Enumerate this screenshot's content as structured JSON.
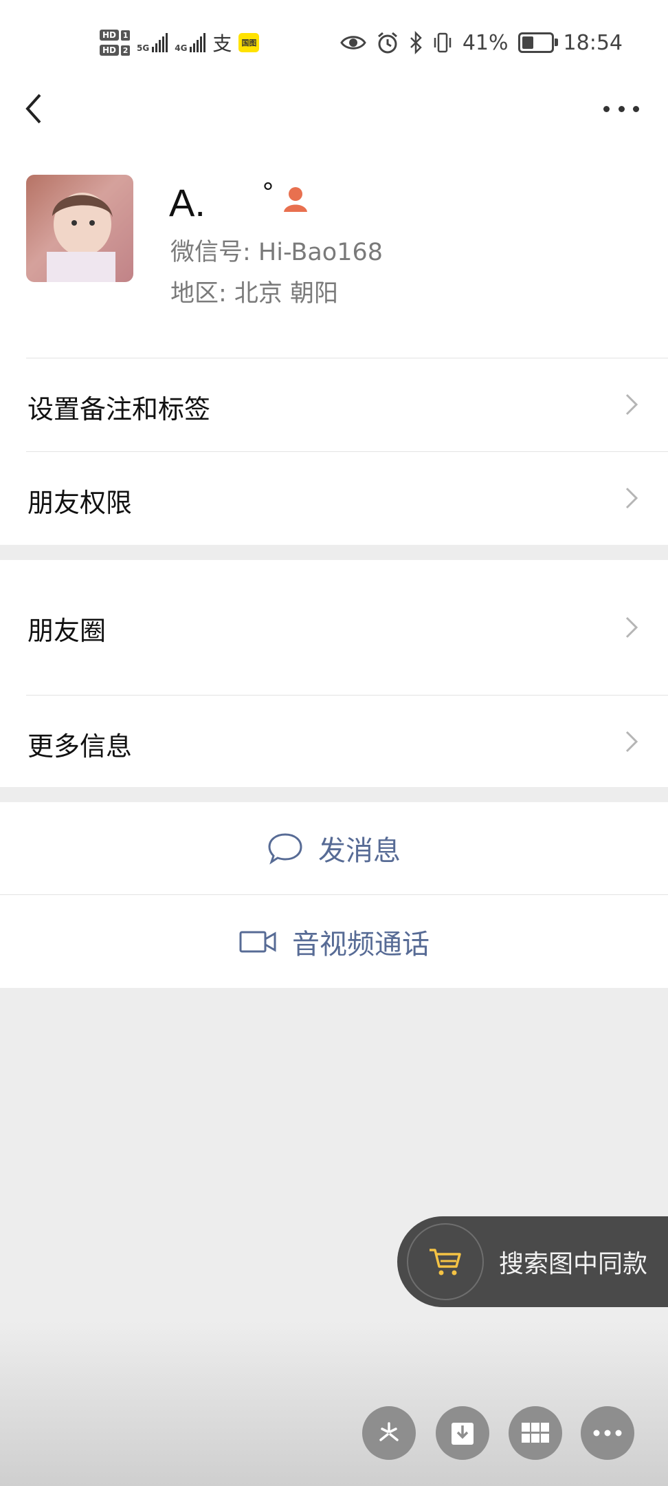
{
  "status_bar": {
    "hd1": "HD",
    "hd1_num": "1",
    "hd2": "HD",
    "hd2_num": "2",
    "net1": "5G",
    "net2": "4G",
    "pay_glyph": "支",
    "promo_badge": "国图",
    "battery_level_percent": 41,
    "battery_text": "41%",
    "time": "18:54",
    "icons": [
      "eye-icon",
      "alarm-icon",
      "bluetooth-icon",
      "vibrate-icon",
      "battery-icon"
    ]
  },
  "nav": {
    "back_icon": "chevron-left-icon",
    "more_icon": "more-dots-icon"
  },
  "profile": {
    "nickname": "A.",
    "nickname_suffix": "°",
    "gender_icon": "female-icon",
    "gender_color": "#e8704f",
    "wechat_id": "微信号:  Hi-Bao168",
    "region": "地区:  北京  朝阳"
  },
  "rows": [
    {
      "label": "设置备注和标签"
    },
    {
      "label": "朋友权限"
    },
    {
      "label": "朋友圈"
    },
    {
      "label": "更多信息"
    }
  ],
  "actions": {
    "message": "发消息",
    "video_call": "音视频通话",
    "accent_color": "#576b95"
  },
  "floating": {
    "search_similar": "搜索图中同款",
    "cart_color": "#f5c344"
  },
  "toolbar": {
    "buttons": [
      "sparkle-icon",
      "download-icon",
      "grid-icon",
      "more-icon"
    ]
  }
}
